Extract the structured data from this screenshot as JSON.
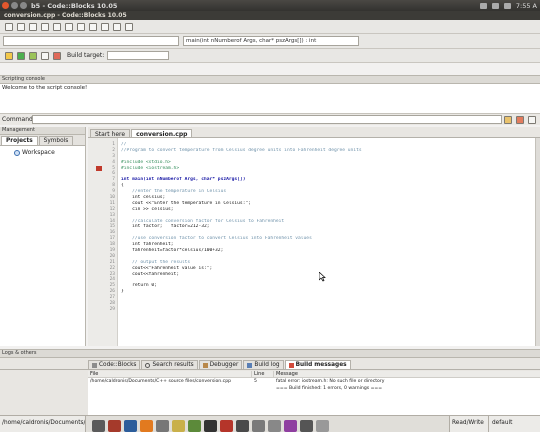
{
  "window": {
    "title": "b5 - Code::Blocks 10.05",
    "file_title": "conversion.cpp - Code::Blocks 10.05"
  },
  "tray": {
    "clock": "7:55 A"
  },
  "toolbar": {
    "function_combo": "main(int nNumberof Args, char* pszArgs[]) : int",
    "build_target_label": "Build target:"
  },
  "scripting": {
    "title": "Scripting console",
    "message": "Welcome to the script console!",
    "command_label": "Command:"
  },
  "management": {
    "title": "Management",
    "tabs": [
      "Projects",
      "Symbols"
    ],
    "tree_root": "Workspace"
  },
  "editor": {
    "tabs": [
      "Start here",
      "conversion.cpp"
    ],
    "line_numbers": [
      "1",
      "2",
      "3",
      "4",
      "5",
      "6",
      "7",
      "8",
      "9",
      "10",
      "11",
      "12",
      "13",
      "14",
      "15",
      "16",
      "17",
      "18",
      "19",
      "20",
      "21",
      "22",
      "23",
      "24",
      "25",
      "26",
      "27",
      "28",
      "29"
    ],
    "lines": [
      {
        "cls": "c-cm",
        "text": "//"
      },
      {
        "cls": "c-cm",
        "text": "//Program to convert temperature from Celsius degree units into Fahrenheit degree units"
      },
      {
        "cls": "c-cm",
        "text": ""
      },
      {
        "cls": "c-pp",
        "text": "#include <stdio.h>"
      },
      {
        "cls": "c-pp",
        "text": "#include <iostream.h>"
      },
      {
        "cls": "c-tx",
        "text": ""
      },
      {
        "cls": "c-kw",
        "text": "int main(int nNumberof Args, char* pszArgs[])"
      },
      {
        "cls": "c-tx",
        "text": "{"
      },
      {
        "cls": "c-cm",
        "text": "    //enter the temperature in Celsius"
      },
      {
        "cls": "c-tx",
        "text": "    int celsius;"
      },
      {
        "cls": "c-tx",
        "text": "    cout <<\"Enter the temperature in Celsius:\";"
      },
      {
        "cls": "c-tx",
        "text": "    cin >> celsius;"
      },
      {
        "cls": "c-tx",
        "text": ""
      },
      {
        "cls": "c-cm",
        "text": "    //calculate conversion factor for Celsius to Fahrenheit"
      },
      {
        "cls": "c-tx",
        "text": "    int factor;   factor=212-32;"
      },
      {
        "cls": "c-tx",
        "text": ""
      },
      {
        "cls": "c-cm",
        "text": "    //use conversion factor to convert Celsius into Fahrenheit values"
      },
      {
        "cls": "c-tx",
        "text": "    int fahrenheit;"
      },
      {
        "cls": "c-tx",
        "text": "    fahrenheit=factor*celsius/100+32;"
      },
      {
        "cls": "c-tx",
        "text": ""
      },
      {
        "cls": "c-cm",
        "text": "    // output the results"
      },
      {
        "cls": "c-tx",
        "text": "    cout<<\"Fahrenheit value is:\";"
      },
      {
        "cls": "c-tx",
        "text": "    cout<<fahrenheit;"
      },
      {
        "cls": "c-tx",
        "text": ""
      },
      {
        "cls": "c-tx",
        "text": "    return 0;"
      },
      {
        "cls": "c-tx",
        "text": "}"
      },
      {
        "cls": "c-tx",
        "text": ""
      },
      {
        "cls": "c-tx",
        "text": ""
      },
      {
        "cls": "c-tx",
        "text": ""
      }
    ]
  },
  "logs": {
    "title": "Logs & others",
    "tabs": [
      "Code::Blocks",
      "Search results",
      "Debugger",
      "Build log",
      "Build messages"
    ],
    "columns": [
      "File",
      "Line",
      "Message"
    ],
    "rows": [
      {
        "file": "/home/caldronis/Documents/C++ source files/conversion.cpp",
        "line": "5",
        "message": "fatal error: iostream.h: No such file or directory"
      },
      {
        "file": "",
        "line": "",
        "message": "=== Build finished: 1 errors, 0 warnings ==="
      }
    ]
  },
  "status": {
    "path": "/home/caldronis/Documents/C",
    "mode": "Read/Write",
    "profile": "default"
  }
}
